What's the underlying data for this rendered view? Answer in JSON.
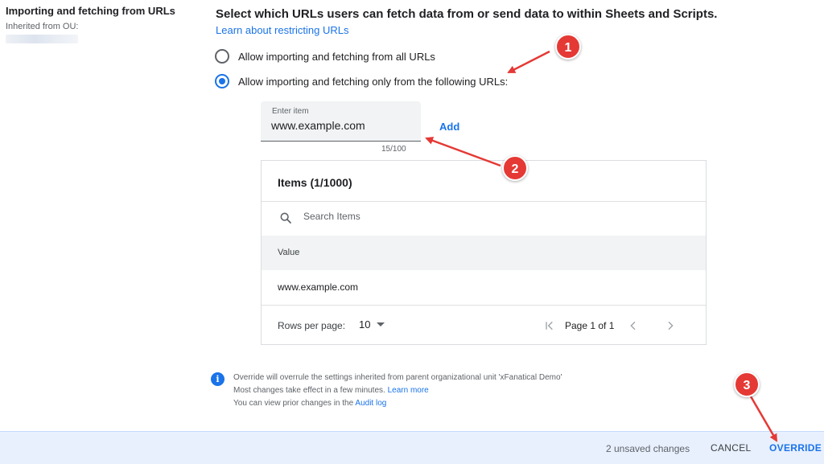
{
  "section": {
    "title": "Importing and fetching from URLs",
    "inherited_label": "Inherited from OU:"
  },
  "main": {
    "title": "Select which URLs users can fetch data from or send data to within Sheets and Scripts.",
    "learn_link": "Learn about restricting URLs",
    "options": [
      {
        "label": "Allow importing and fetching from all URLs",
        "checked": false
      },
      {
        "label": "Allow importing and fetching only from the following URLs:",
        "checked": true
      }
    ]
  },
  "entry": {
    "label": "Enter item",
    "value": "www.example.com",
    "counter": "15/100",
    "add_label": "Add"
  },
  "items_table": {
    "title": "Items (1/1000)",
    "search_placeholder": "Search Items",
    "column_header": "Value",
    "rows": [
      "www.example.com"
    ],
    "rows_per_page_label": "Rows per page:",
    "rows_per_page_value": "10",
    "page_info": "Page 1 of 1"
  },
  "info": {
    "line1": "Override will overrule the settings inherited from parent organizational unit 'xFanatical Demo'",
    "line2_text": "Most changes take effect in a few minutes.",
    "line2_link": "Learn more",
    "line3_text": "You can view prior changes in the",
    "line3_link": "Audit log"
  },
  "footer": {
    "unsaved": "2 unsaved changes",
    "cancel": "CANCEL",
    "override": "OVERRIDE"
  },
  "annotations": {
    "badges": [
      "1",
      "2",
      "3"
    ]
  },
  "colors": {
    "accent": "#1a73e8",
    "annotation_red": "#e53935",
    "footer_bg": "#e8f0fe"
  },
  "icons": [
    "search-icon",
    "first-page-icon",
    "chevron-left-icon",
    "chevron-right-icon",
    "info-icon",
    "dropdown-caret-icon"
  ]
}
